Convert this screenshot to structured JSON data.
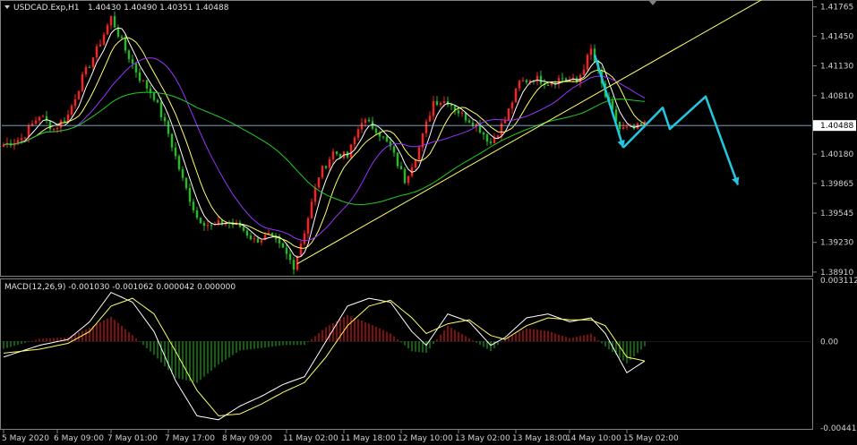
{
  "header": {
    "symbol": "USDCAD.Exp,H1",
    "ohlc": "1.40430 1.40490 1.40351 1.40488"
  },
  "macd_header": "MACD(12,26,9) -0.001030 -0.001062 0.000042 0.000000",
  "colors": {
    "background": "#000000",
    "bull": "#ff1f1f",
    "bear": "#1fbf1f",
    "ma_fast": "#ffffff",
    "ma_mid": "#ffff66",
    "ma_slow": "#9933ff",
    "ma_long": "#22cc22",
    "trendline": "#ffff66",
    "forecast": "#22c8e0",
    "current_price_line": "#8ab4d8"
  },
  "chart_data": [
    {
      "type": "candlestick",
      "pane": "main",
      "symbol": "USDCAD",
      "timeframe": "H1",
      "ylim": [
        1.3888,
        1.4182
      ],
      "price_axis_labels": [
        "1.41765",
        "1.41450",
        "1.41130",
        "1.40810",
        "1.40488",
        "1.40180",
        "1.39865",
        "1.39545",
        "1.39230",
        "1.38910"
      ],
      "price_axis_values": [
        1.41765,
        1.4145,
        1.4113,
        1.4081,
        1.40488,
        1.4018,
        1.39865,
        1.39545,
        1.3923,
        1.3891
      ],
      "current_price": 1.40488,
      "x_labels": [
        "5 May 2020",
        "6 May 09:00",
        "7 May 01:00",
        "7 May 17:00",
        "8 May 09:00",
        "11 May 02:00",
        "11 May 18:00",
        "12 May 10:00",
        "13 May 02:00",
        "13 May 18:00",
        "14 May 10:00",
        "15 May 02:00"
      ],
      "price_path": [
        {
          "i": 0,
          "p": 1.4028
        },
        {
          "i": 5,
          "p": 1.4035
        },
        {
          "i": 10,
          "p": 1.406
        },
        {
          "i": 14,
          "p": 1.4045
        },
        {
          "i": 18,
          "p": 1.406
        },
        {
          "i": 22,
          "p": 1.41
        },
        {
          "i": 26,
          "p": 1.413
        },
        {
          "i": 30,
          "p": 1.4165
        },
        {
          "i": 34,
          "p": 1.413
        },
        {
          "i": 38,
          "p": 1.41
        },
        {
          "i": 42,
          "p": 1.408
        },
        {
          "i": 46,
          "p": 1.404
        },
        {
          "i": 50,
          "p": 1.399
        },
        {
          "i": 54,
          "p": 1.395
        },
        {
          "i": 58,
          "p": 1.394
        },
        {
          "i": 62,
          "p": 1.3945
        },
        {
          "i": 66,
          "p": 1.394
        },
        {
          "i": 70,
          "p": 1.3925
        },
        {
          "i": 74,
          "p": 1.393
        },
        {
          "i": 78,
          "p": 1.3915
        },
        {
          "i": 81,
          "p": 1.3898
        },
        {
          "i": 84,
          "p": 1.3935
        },
        {
          "i": 88,
          "p": 1.3995
        },
        {
          "i": 92,
          "p": 1.402
        },
        {
          "i": 96,
          "p": 1.4015
        },
        {
          "i": 100,
          "p": 1.4055
        },
        {
          "i": 104,
          "p": 1.4045
        },
        {
          "i": 108,
          "p": 1.4025
        },
        {
          "i": 112,
          "p": 1.399
        },
        {
          "i": 116,
          "p": 1.4025
        },
        {
          "i": 120,
          "p": 1.4075
        },
        {
          "i": 124,
          "p": 1.4075
        },
        {
          "i": 128,
          "p": 1.406
        },
        {
          "i": 132,
          "p": 1.405
        },
        {
          "i": 136,
          "p": 1.403
        },
        {
          "i": 140,
          "p": 1.4055
        },
        {
          "i": 144,
          "p": 1.4095
        },
        {
          "i": 148,
          "p": 1.41
        },
        {
          "i": 152,
          "p": 1.4095
        },
        {
          "i": 156,
          "p": 1.41
        },
        {
          "i": 160,
          "p": 1.4095
        },
        {
          "i": 164,
          "p": 1.413
        },
        {
          "i": 168,
          "p": 1.408
        },
        {
          "i": 172,
          "p": 1.4045
        },
        {
          "i": 176,
          "p": 1.4045
        },
        {
          "i": 179,
          "p": 1.405
        }
      ],
      "candles_count": 180,
      "overlays": {
        "trendline": {
          "from": {
            "i": 82,
            "p": 1.39
          },
          "to": {
            "i": 212,
            "p": 1.4185
          }
        },
        "forecast_arrows": [
          {
            "points": [
              {
                "i": 165,
                "p": 1.4125
              },
              {
                "i": 173,
                "p": 1.4025
              }
            ]
          },
          {
            "points": [
              {
                "i": 173,
                "p": 1.4025
              },
              {
                "i": 184,
                "p": 1.4068
              },
              {
                "i": 186,
                "p": 1.4045
              },
              {
                "i": 196,
                "p": 1.408
              },
              {
                "i": 205,
                "p": 1.3985
              }
            ]
          }
        ]
      }
    },
    {
      "type": "macd",
      "pane": "indicator",
      "params": [
        12,
        26,
        9
      ],
      "ylim": [
        -0.00442,
        0.00312
      ],
      "axis_labels": [
        "0.003112",
        "0.00",
        "-0.004415"
      ],
      "axis_values": [
        0.003112,
        0.0,
        -0.004415
      ],
      "main_path": [
        {
          "i": 0,
          "v": -0.0008
        },
        {
          "i": 10,
          "v": -0.0002
        },
        {
          "i": 18,
          "v": 0.0001
        },
        {
          "i": 24,
          "v": 0.001
        },
        {
          "i": 30,
          "v": 0.0025
        },
        {
          "i": 36,
          "v": 0.002
        },
        {
          "i": 42,
          "v": 0.0005
        },
        {
          "i": 48,
          "v": -0.002
        },
        {
          "i": 54,
          "v": -0.0038
        },
        {
          "i": 60,
          "v": -0.004
        },
        {
          "i": 66,
          "v": -0.0033
        },
        {
          "i": 72,
          "v": -0.0028
        },
        {
          "i": 78,
          "v": -0.0022
        },
        {
          "i": 84,
          "v": -0.0018
        },
        {
          "i": 90,
          "v": 0.0
        },
        {
          "i": 96,
          "v": 0.0018
        },
        {
          "i": 102,
          "v": 0.0022
        },
        {
          "i": 108,
          "v": 0.002
        },
        {
          "i": 114,
          "v": 0.0005
        },
        {
          "i": 118,
          "v": -0.0002
        },
        {
          "i": 124,
          "v": 0.0014
        },
        {
          "i": 130,
          "v": 0.001
        },
        {
          "i": 136,
          "v": -0.0002
        },
        {
          "i": 140,
          "v": 0.0002
        },
        {
          "i": 146,
          "v": 0.0012
        },
        {
          "i": 152,
          "v": 0.0014
        },
        {
          "i": 158,
          "v": 0.001
        },
        {
          "i": 164,
          "v": 0.0012
        },
        {
          "i": 168,
          "v": 0.0004
        },
        {
          "i": 174,
          "v": -0.0016
        },
        {
          "i": 179,
          "v": -0.001
        }
      ],
      "signal_path": [
        {
          "i": 0,
          "v": -0.0006
        },
        {
          "i": 10,
          "v": -0.0004
        },
        {
          "i": 18,
          "v": -0.0001
        },
        {
          "i": 24,
          "v": 0.0005
        },
        {
          "i": 30,
          "v": 0.0018
        },
        {
          "i": 36,
          "v": 0.0022
        },
        {
          "i": 42,
          "v": 0.0014
        },
        {
          "i": 48,
          "v": -0.0005
        },
        {
          "i": 54,
          "v": -0.0025
        },
        {
          "i": 60,
          "v": -0.0038
        },
        {
          "i": 66,
          "v": -0.0037
        },
        {
          "i": 72,
          "v": -0.0032
        },
        {
          "i": 78,
          "v": -0.0026
        },
        {
          "i": 84,
          "v": -0.0021
        },
        {
          "i": 90,
          "v": -0.0008
        },
        {
          "i": 96,
          "v": 0.0008
        },
        {
          "i": 102,
          "v": 0.0018
        },
        {
          "i": 108,
          "v": 0.0021
        },
        {
          "i": 114,
          "v": 0.0012
        },
        {
          "i": 118,
          "v": 0.0004
        },
        {
          "i": 124,
          "v": 0.0009
        },
        {
          "i": 130,
          "v": 0.0011
        },
        {
          "i": 136,
          "v": 0.0003
        },
        {
          "i": 140,
          "v": 0.0001
        },
        {
          "i": 146,
          "v": 0.0008
        },
        {
          "i": 152,
          "v": 0.0012
        },
        {
          "i": 158,
          "v": 0.0011
        },
        {
          "i": 164,
          "v": 0.0011
        },
        {
          "i": 168,
          "v": 0.0008
        },
        {
          "i": 174,
          "v": -0.0008
        },
        {
          "i": 179,
          "v": -0.001
        }
      ]
    }
  ]
}
